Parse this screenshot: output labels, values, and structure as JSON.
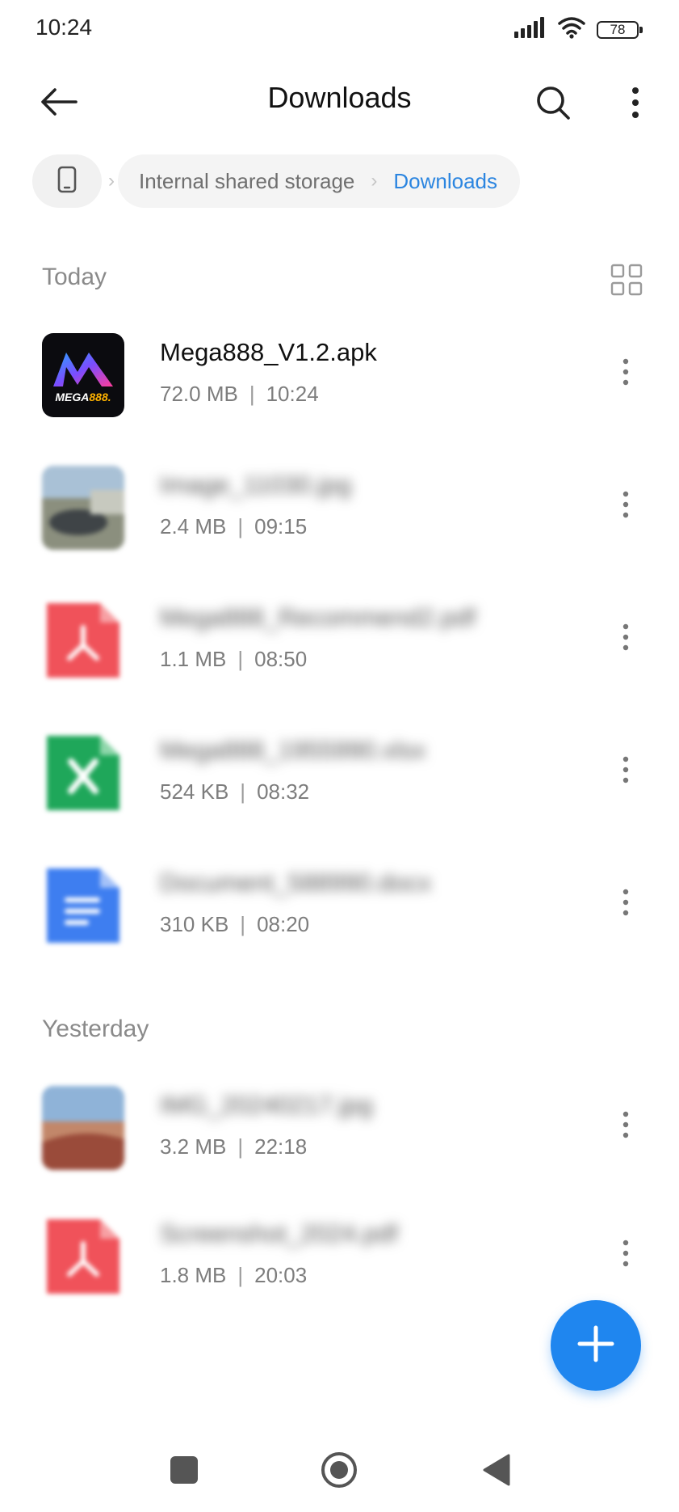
{
  "status_bar": {
    "time": "10:24",
    "battery": "78",
    "icons": [
      "signal-icon",
      "wifi-icon",
      "battery-icon"
    ]
  },
  "app_bar": {
    "title": "Downloads",
    "icons": [
      "back-arrow-icon",
      "search-icon",
      "more-vert-icon"
    ]
  },
  "breadcrumb": {
    "device_icon": "phone-icon",
    "storage": "Internal shared storage",
    "current": "Downloads"
  },
  "sections": [
    {
      "label": "Today",
      "files": [
        {
          "name": "Mega888_V1.2.apk",
          "size": "72.0 MB",
          "time": "10:24",
          "icon": "apk-app-icon",
          "blurred": false
        },
        {
          "name": "Image_11030.jpg",
          "size": "2.4 MB",
          "time": "09:15",
          "icon": "image-thumbnail",
          "blurred": true
        },
        {
          "name": "Mega888_Recommend2.pdf",
          "size": "1.1 MB",
          "time": "08:50",
          "icon": "pdf-icon",
          "blurred": true
        },
        {
          "name": "Mega888_1955990.xlsx",
          "size": "524 KB",
          "time": "08:32",
          "icon": "excel-icon",
          "blurred": true
        },
        {
          "name": "Document_588990.docx",
          "size": "310 KB",
          "time": "08:20",
          "icon": "doc-icon",
          "blurred": true
        }
      ]
    },
    {
      "label": "Yesterday",
      "files": [
        {
          "name": "IMG_20240217.jpg",
          "size": "3.2 MB",
          "time": "22:18",
          "icon": "image-thumbnail",
          "blurred": true
        },
        {
          "name": "Screenshot_2024.pdf",
          "size": "1.8 MB",
          "time": "20:03",
          "icon": "pdf-icon",
          "blurred": true
        }
      ]
    }
  ],
  "view_toggle_icon": "grid-view-icon",
  "fab_icon": "plus-icon",
  "nav_bar": [
    "recents-square-icon",
    "home-circle-icon",
    "back-triangle-icon"
  ],
  "colors": {
    "accent": "#2b85e0",
    "fab": "#1f86ef",
    "pdf": "#f0525a",
    "excel": "#1fa75a",
    "doc": "#3e7ef0"
  }
}
